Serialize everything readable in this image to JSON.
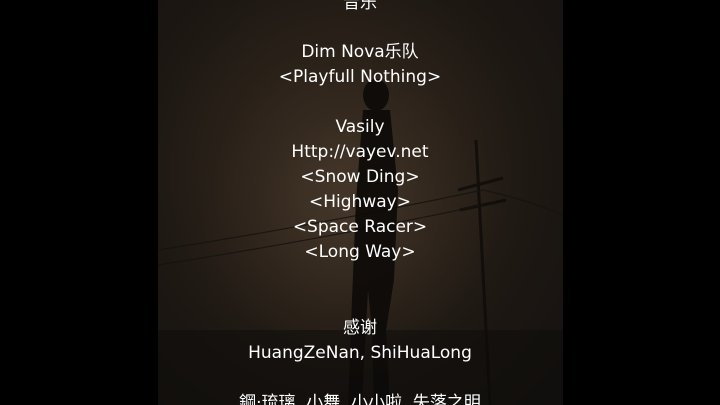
{
  "credits": {
    "lines": [
      "音乐",
      "Dim Nova乐队",
      "<Playfull Nothing>",
      "Vasily",
      "Http://vayev.net",
      "<Snow Ding>",
      "<Highway>",
      "<Space Racer>",
      "<Long Way>",
      "感谢",
      "HuangZeNan, ShiHuaLong",
      "鋼·琉璃, 小舞, 小小啦, 失落之明"
    ]
  }
}
